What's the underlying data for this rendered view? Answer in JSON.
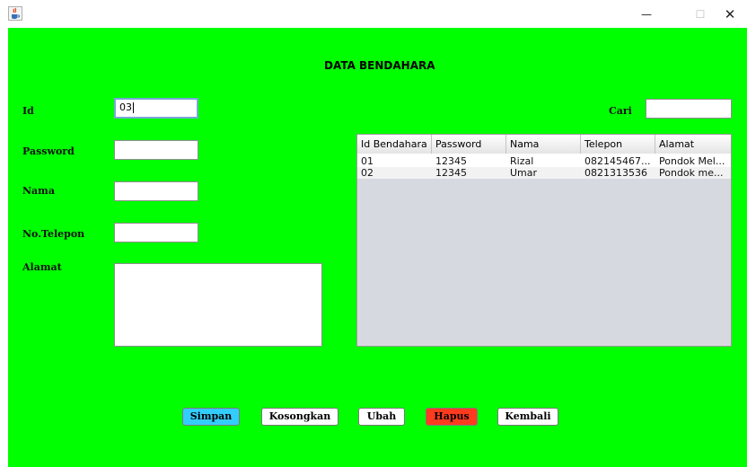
{
  "window": {
    "minimize_glyph": "—",
    "maximize_glyph": "☐",
    "close_glyph": "✕",
    "app_icon": "java-cup-icon"
  },
  "colors": {
    "background": "#00ff00",
    "simpan": "#33ccff",
    "hapus": "#ff3b1f",
    "default_button": "#ffffff"
  },
  "form": {
    "title": "DATA BENDAHARA",
    "id_label": "Id",
    "id_value": "03",
    "password_label": "Password",
    "password_value": "",
    "nama_label": "Nama",
    "nama_value": "",
    "telepon_label": "No.Telepon",
    "telepon_value": "",
    "alamat_label": "Alamat",
    "alamat_value": "",
    "cari_label": "Cari",
    "cari_value": ""
  },
  "table": {
    "columns": [
      "Id Bendahara",
      "Password",
      "Nama",
      "Telepon",
      "Alamat"
    ],
    "rows": [
      [
        "01",
        "12345",
        "Rizal",
        "082145467...",
        "Pondok Mel..."
      ],
      [
        "02",
        "12345",
        "Umar",
        "0821313536",
        "Pondok me..."
      ]
    ]
  },
  "buttons": {
    "simpan": "Simpan",
    "kosongkan": "Kosongkan",
    "ubah": "Ubah",
    "hapus": "Hapus",
    "kembali": "Kembali"
  }
}
